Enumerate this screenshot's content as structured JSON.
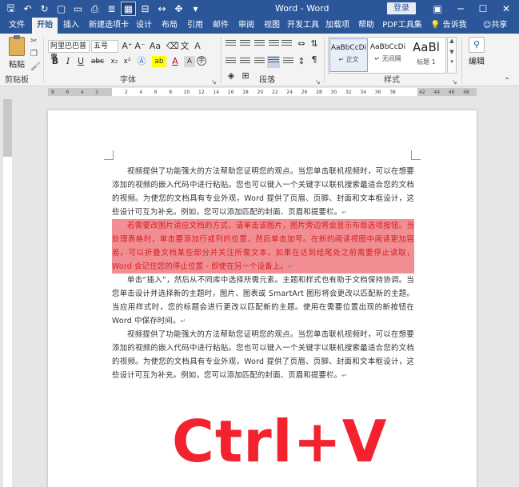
{
  "titlebar": {
    "title": "Word - Word",
    "signin": "登录",
    "qat": [
      {
        "name": "save-icon",
        "glyph": "🖫"
      },
      {
        "name": "undo-icon",
        "glyph": "↶"
      },
      {
        "name": "redo-icon",
        "glyph": "↻"
      },
      {
        "name": "new-doc-icon",
        "glyph": "▢"
      },
      {
        "name": "open-folder-icon",
        "glyph": "▭"
      },
      {
        "name": "print-preview-icon",
        "glyph": "⎙"
      },
      {
        "name": "read-mode-icon",
        "glyph": "≣"
      },
      {
        "name": "table-icon",
        "glyph": "▦"
      },
      {
        "name": "align-icon",
        "glyph": "⊟"
      },
      {
        "name": "spacing-icon",
        "glyph": "↔"
      },
      {
        "name": "touch-mode-icon",
        "glyph": "✥"
      },
      {
        "name": "customize-qat-icon",
        "glyph": "▾"
      }
    ],
    "controls": {
      "ribbon_display": "▣",
      "minimize": "─",
      "maximize": "☐",
      "close": "✕"
    }
  },
  "tabs": [
    "文件",
    "开始",
    "插入",
    "新建选项卡",
    "设计",
    "布局",
    "引用",
    "邮件",
    "审阅",
    "视图",
    "开发工具",
    "加载项",
    "帮助",
    "PDF工具集"
  ],
  "active_tab": "开始",
  "tellme": "告诉我",
  "share": "共享",
  "ribbon": {
    "clipboard": {
      "paste": "粘贴",
      "label": "剪贴板"
    },
    "font": {
      "name": "阿里巴巴普惠",
      "size": "五号",
      "label": "字体",
      "buttons": [
        "B",
        "I",
        "U",
        "abc",
        "x₂",
        "x²"
      ],
      "grow": "A⁺",
      "shrink": "A⁻",
      "case": "Aa",
      "font_color": "A",
      "highlight": "ab"
    },
    "paragraph": {
      "label": "段落"
    },
    "styles": {
      "label": "样式",
      "items": [
        {
          "sample": "AaBbCcDi",
          "name": "↵ 正文"
        },
        {
          "sample": "AaBbCcDi",
          "name": "↵ 无间隔"
        },
        {
          "sample": "AaBl",
          "name": "标题 1"
        }
      ]
    },
    "editing": {
      "label": "编辑"
    }
  },
  "ruler": {
    "ticks": [
      "8",
      "6",
      "4",
      "2",
      "",
      "2",
      "4",
      "6",
      "8",
      "10",
      "12",
      "14",
      "16",
      "18",
      "20",
      "22",
      "24",
      "26",
      "28",
      "30",
      "32",
      "34",
      "36",
      "38",
      "",
      "42",
      "44",
      "46",
      "48"
    ]
  },
  "document": {
    "paragraphs": [
      {
        "text": "视频提供了功能强大的方法帮助您证明您的观点。当您单击联机视频时，可以在想要添加的视频的嵌入代码中进行粘贴。您也可以键入一个关键字以联机搜索最适合您的文档的视频。为使您的文档具有专业外观，Word 提供了页眉、页脚、封面和文本框设计，这些设计可互为补充。例如，您可以添加匹配的封面、页眉和提要栏。",
        "highlight": false
      },
      {
        "text": "若需要改图片适应文档的方式，请单击该图片，图片旁边将会显示布局选项按钮。当处理表格时，单击要添加行或列的位置，然后单击加号。在新的阅读视图中阅读更加容易。可以折叠文档某些部分并关注所需文本。如果在达到结尾处之前需要停止读取，Word 会记住您的停止位置 - 即使在另一个设备上。",
        "highlight": true
      },
      {
        "text": "单击“插入”，然后从不同库中选择所需元素。主题和样式也有助于文档保持协调。当您单击设计并选择新的主题时，图片、图表或 SmartArt 图形将会更改以匹配新的主题。当应用样式时，您的标题会进行更改以匹配新的主题。使用在需要位置出现的新按钮在 Word 中保存时间。",
        "highlight": false
      },
      {
        "text": "视频提供了功能强大的方法帮助您证明您的观点。当您单击联机视频时，可以在想要添加的视频的嵌入代码中进行粘贴。您也可以键入一个关键字以联机搜索最适合您的文档的视频。为使您的文档具有专业外观，Word 提供了页眉、页脚、封面和文本框设计，这些设计可互为补充。例如，您可以添加匹配的封面、页眉和提要栏。",
        "highlight": false
      }
    ],
    "para_mark": "↵",
    "overlay_caption": "Ctrl+V"
  },
  "colors": {
    "brand": "#2b579a",
    "highlight_bg": "#f08e94",
    "highlight_text": "#d81e1e",
    "caption": "#f3222f"
  }
}
